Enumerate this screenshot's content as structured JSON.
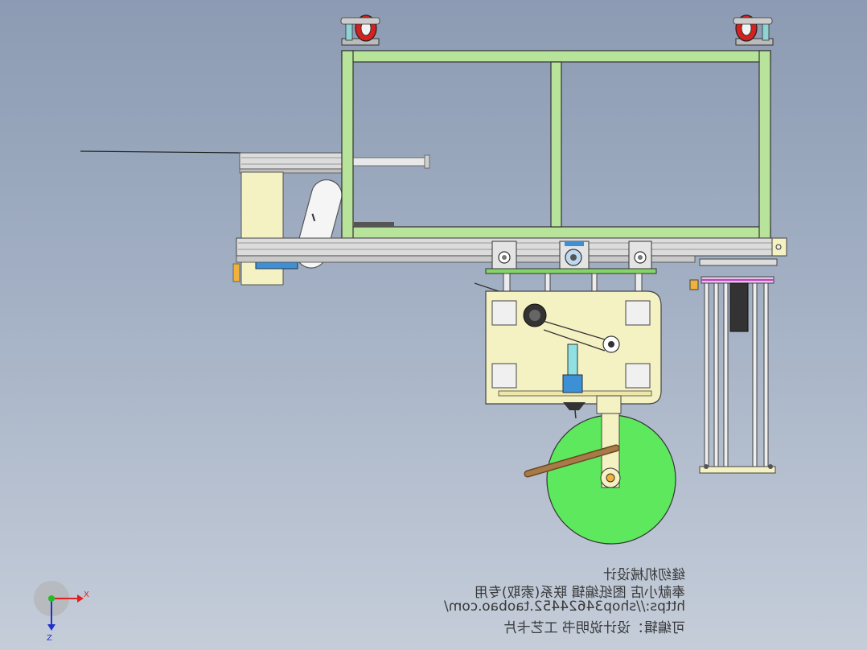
{
  "watermark": {
    "line1": "可编辑：设计说明书 工艺卡片",
    "line2": "https://shop34624452.taobao.com/",
    "line3": "奉献小店 图纸编辑 联系(索取)专用",
    "line4": "缝纫机械设计"
  },
  "triad": {
    "x_label": "X",
    "z_label": "Z"
  },
  "colors": {
    "frame_green": "#b8e39a",
    "plate_cream": "#f4f1c2",
    "wheel_green": "#5ee85e",
    "caster_red": "#d42020",
    "rail_gray": "#d9d9d9",
    "arm_brown": "#9a6b3a",
    "accent_blue": "#3d8fd6",
    "accent_pink": "#c040c0"
  }
}
